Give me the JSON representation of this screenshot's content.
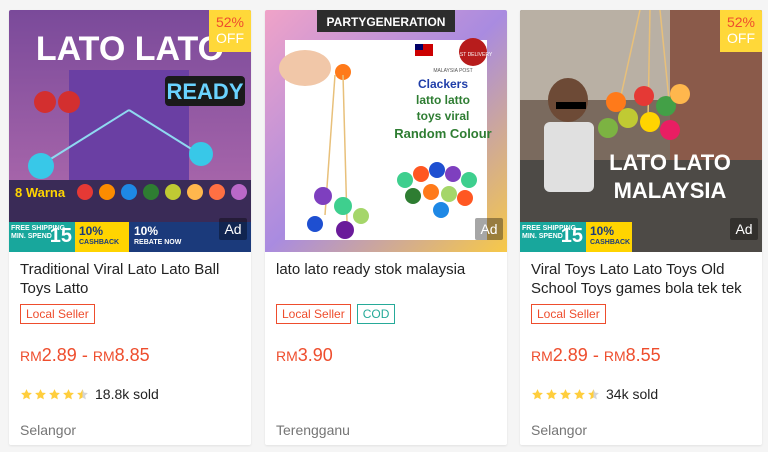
{
  "products": [
    {
      "title": "Traditional Viral Lato Lato Ball Toys Latto",
      "image_texts": {
        "headline": "LATO LATO",
        "badge": "READY",
        "colors_label": "8 Warna"
      },
      "discount_pct": "52%",
      "discount_off": "OFF",
      "ad_label": "Ad",
      "promo": {
        "free_shipping": "FREE SHIPPING",
        "min_spend": "MIN. SPEND",
        "amount": "15",
        "cashback_pct": "10%",
        "cashback": "CASHBACK",
        "rebate_pct": "10%",
        "rebate": "REBATE NOW"
      },
      "tags": [
        "Local Seller"
      ],
      "price_from_currency": "RM",
      "price_from": "2.89",
      "price_sep": " - ",
      "price_to_currency": "RM",
      "price_to": "8.85",
      "rating": 4.5,
      "sold": "18.8k sold",
      "location": "Selangor"
    },
    {
      "title": "lato lato ready stok malaysia",
      "image_texts": {
        "banner": "PARTYGENERATION",
        "line1": "Clackers",
        "line2": "latto latto",
        "line3": "toys viral",
        "line4": "Random Colour",
        "fast": "FAST DELIVERY",
        "post": "MALAYSIA POST"
      },
      "ad_label": "Ad",
      "tags": [
        "Local Seller",
        "COD"
      ],
      "price_currency": "RM",
      "price": "3.90",
      "location": "Terengganu"
    },
    {
      "title": "Viral Toys Lato Lato Toys Old School Toys games bola tek tek",
      "image_texts": {
        "line1": "LATO LATO",
        "line2": "MALAYSIA"
      },
      "discount_pct": "52%",
      "discount_off": "OFF",
      "ad_label": "Ad",
      "promo": {
        "free_shipping": "FREE SHIPPING",
        "min_spend": "MIN. SPEND",
        "amount": "15",
        "cashback_pct": "10%",
        "cashback": "CASHBACK"
      },
      "tags": [
        "Local Seller"
      ],
      "price_from_currency": "RM",
      "price_from": "2.89",
      "price_sep": " - ",
      "price_to_currency": "RM",
      "price_to": "8.55",
      "rating": 4.5,
      "sold": "34k sold",
      "location": "Selangor"
    }
  ],
  "colors": {
    "accent": "#ee4d2d",
    "cod": "#26aa99",
    "star": "#ffce3d",
    "discount_bg": "#ffd839"
  }
}
